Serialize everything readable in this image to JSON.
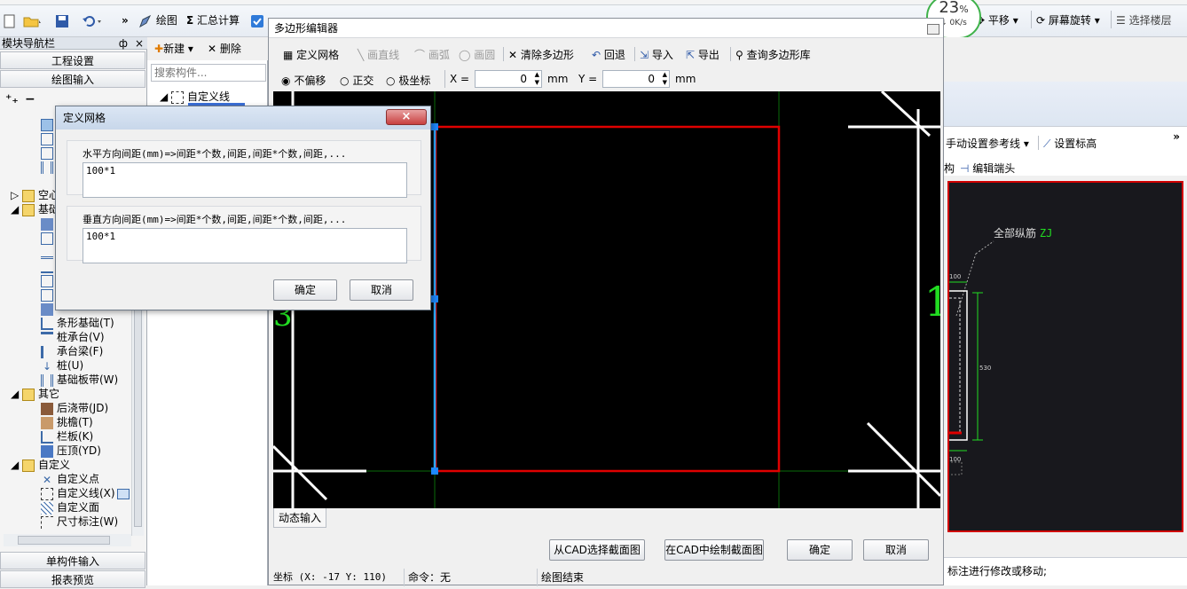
{
  "toolbar": {
    "draw_label": "绘图",
    "sum_label": "汇总计算",
    "pan_label": "平移",
    "rotate_label": "屏幕旋转",
    "select_floor_label": "选择楼层"
  },
  "network_widget": {
    "percent": "23",
    "percent_sign": "%",
    "speed": "0K/s"
  },
  "nav": {
    "title": "模块导航栏",
    "pin": "ф",
    "close": "×",
    "project_settings": "工程设置",
    "drawing_input": "绘图输入",
    "tree": {
      "empty_label": "空心",
      "foundation_label": "基础",
      "strip_foundation": "条形基础(T)",
      "pile_cap": "桩承台(V)",
      "cap_beam": "承台梁(F)",
      "pile": "桩(U)",
      "foundation_band": "基础板带(W)",
      "other": "其它",
      "post_pour": "后浇带(JD)",
      "cornice": "挑檐(T)",
      "balustrade": "栏板(K)",
      "coping": "压顶(YD)",
      "custom": "自定义",
      "custom_point": "自定义点",
      "custom_line": "自定义线(X)",
      "custom_face": "自定义面",
      "dimension": "尺寸标注(W)"
    },
    "single_input": "单构件输入",
    "report_preview": "报表预览"
  },
  "components": {
    "new_label": "新建",
    "delete_label": "删除",
    "search_placeholder": "搜索构件...",
    "item_custom_line": "自定义线"
  },
  "editor": {
    "title": "多边形编辑器",
    "define_grid": "定义网格",
    "draw_line": "画直线",
    "draw_arc": "画弧",
    "draw_circle": "画圆",
    "clear_polygon": "清除多边形",
    "undo": "回退",
    "import": "导入",
    "export": "导出",
    "query_library": "查询多边形库",
    "radio_no_offset": "不偏移",
    "radio_ortho": "正交",
    "radio_polar": "极坐标",
    "x_label": "X =",
    "x_value": "0",
    "y_label": "Y =",
    "y_value": "0",
    "unit_mm": "mm",
    "dynamic_input": "动态输入",
    "btn_select_from_cad": "从CAD选择截面图",
    "btn_draw_in_cad": "在CAD中绘制截面图",
    "btn_ok": "确定",
    "btn_cancel": "取消",
    "status_coord": "坐标 (X: -17 Y: 110)",
    "status_command": "命令：无",
    "status_msg": "绘图结束",
    "canvas_label_left": "3",
    "canvas_label_right": "1"
  },
  "right_panel": {
    "set_reference": "手动设置参考线",
    "set_elevation": "设置标高",
    "edit_end": "编辑端头",
    "partial_text": "构",
    "all_rebar": "全部纵筋",
    "rebar_code": "ZJ",
    "dim_100_top": "100",
    "dim_530": "530",
    "dim_100_bottom": "100",
    "hint": "标注进行修改或移动;",
    "chevron": "»"
  },
  "dialog": {
    "title": "定义网格",
    "close": "×",
    "horiz_label": "水平方向间距(mm)=>间距*个数,间距,间距*个数,间距,...",
    "horiz_value": "100*1",
    "vert_label": "垂直方向间距(mm)=>间距*个数,间距,间距*个数,间距,...",
    "vert_value": "100*1",
    "ok": "确定",
    "cancel": "取消"
  },
  "colors": {
    "polygon_red": "#e00000",
    "selected_blue": "#29a9ff",
    "rebar_green": "#22dd22",
    "frame_red": "#d00000"
  }
}
